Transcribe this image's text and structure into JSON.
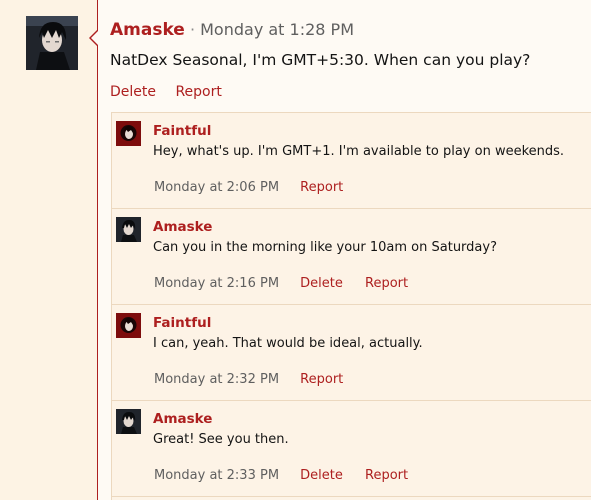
{
  "main_post": {
    "author": "Amaske",
    "separator": "·",
    "time": "Monday at 1:28 PM",
    "body": "NatDex Seasonal, I'm GMT+5:30. When can you play?",
    "actions": [
      "Delete",
      "Report"
    ]
  },
  "replies": [
    {
      "author": "Faintful",
      "avatar": "faintful-avatar",
      "text": "Hey, what's up. I'm GMT+1. I'm available to play on weekends.",
      "time": "Monday at 2:06 PM",
      "actions": [
        "Report"
      ]
    },
    {
      "author": "Amaske",
      "avatar": "amaske-avatar",
      "text": "Can you in the morning like your 10am on Saturday?",
      "time": "Monday at 2:16 PM",
      "actions": [
        "Delete",
        "Report"
      ]
    },
    {
      "author": "Faintful",
      "avatar": "faintful-avatar",
      "text": "I can, yeah. That would be ideal, actually.",
      "time": "Monday at 2:32 PM",
      "actions": [
        "Report"
      ]
    },
    {
      "author": "Amaske",
      "avatar": "amaske-avatar",
      "text": "Great! See you then.",
      "time": "Monday at 2:33 PM",
      "actions": [
        "Delete",
        "Report"
      ]
    }
  ],
  "colors": {
    "accent": "#ad1f1f",
    "page_bg": "#fdf3e4",
    "card_bg": "#fefaf4",
    "reply_bg": "#fdf3e6",
    "border": "#ecd8bf",
    "muted_text": "#5f5f5f"
  }
}
